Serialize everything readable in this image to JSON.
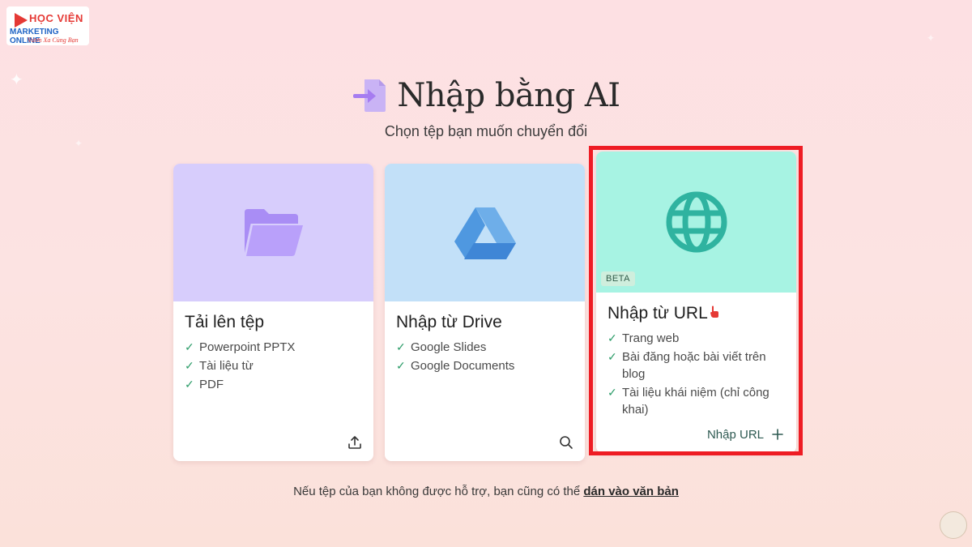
{
  "logo": {
    "line1": "HỌC VIỆN",
    "line2": "MARKETING ONLINE",
    "line3": "Vươn Xa Cùng Bạn"
  },
  "header": {
    "title": "Nhập bằng AI",
    "subtitle": "Chọn tệp bạn muốn chuyển đổi",
    "icon": "file-import-icon"
  },
  "cards": [
    {
      "heading": "Tải lên tệp",
      "icon": "folder-icon",
      "items": [
        "Powerpoint PPTX",
        "Tài liệu từ",
        "PDF"
      ],
      "action_icon": "upload-icon",
      "color": "#d7cdfc"
    },
    {
      "heading": "Nhập từ Drive",
      "icon": "google-drive-icon",
      "items": [
        "Google Slides",
        "Google Documents"
      ],
      "action_icon": "search-icon",
      "color": "#c2e0f8"
    },
    {
      "heading": "Nhập từ URL",
      "icon": "globe-icon",
      "badge": "BETA",
      "items": [
        "Trang web",
        "Bài đăng hoặc bài viết trên blog",
        "Tài liệu khái niệm (chỉ công khai)"
      ],
      "action_label": "Nhập URL",
      "action_icon": "plus-icon",
      "color": "#a7f3e3"
    }
  ],
  "footer": {
    "text": "Nếu tệp của bạn không được hỗ trợ, bạn cũng có thể ",
    "link": "dán vào văn bản"
  },
  "colors": {
    "highlight": "#ee1c24",
    "check": "#2e9d6a"
  }
}
